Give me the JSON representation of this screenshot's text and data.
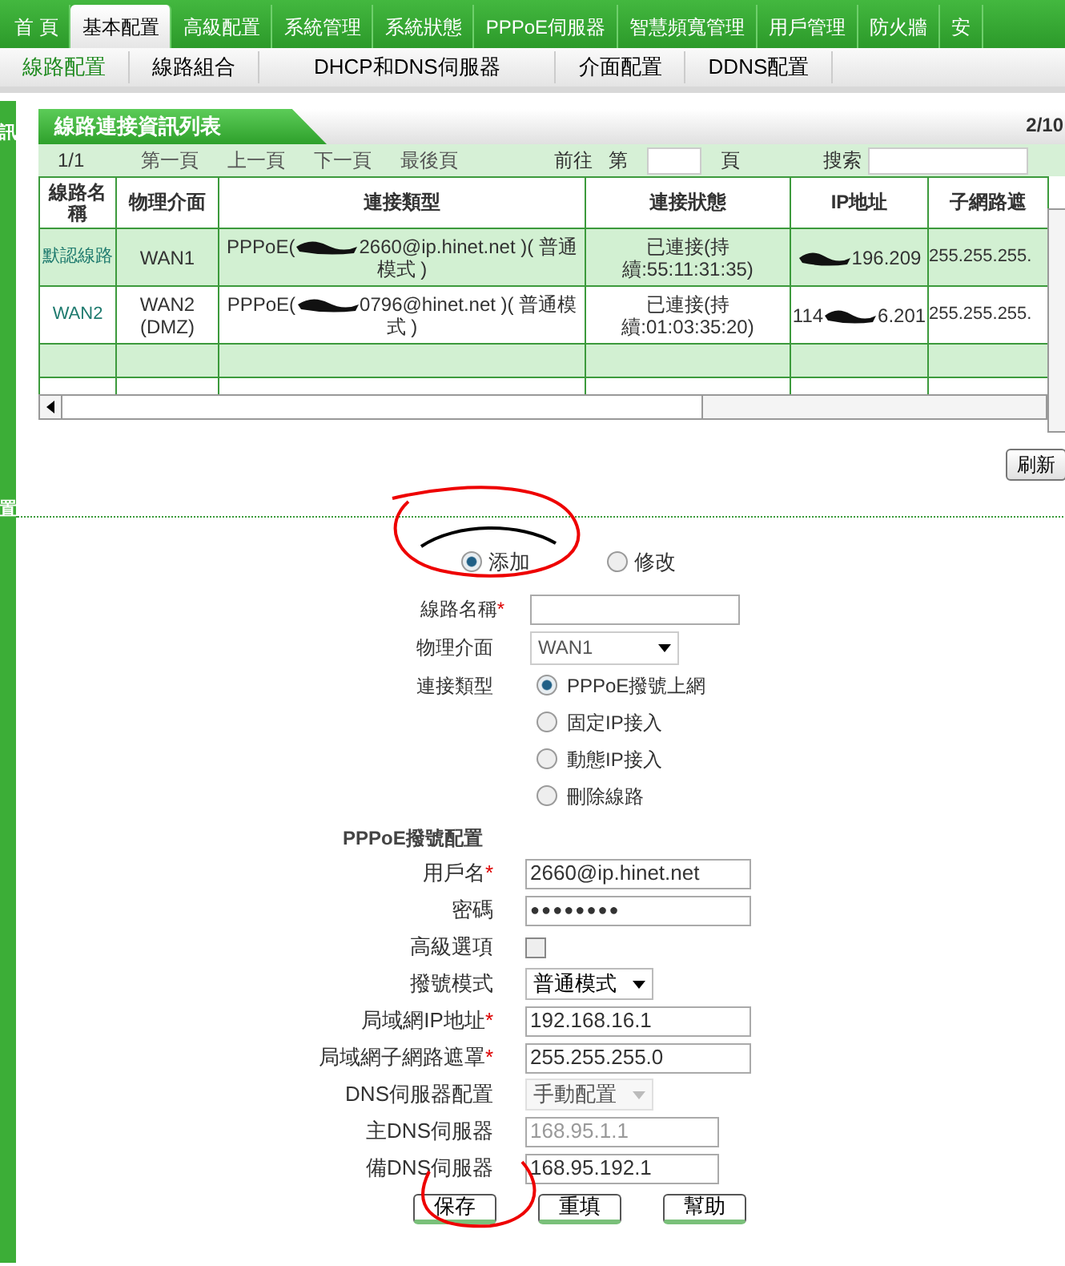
{
  "top_nav": [
    {
      "label": "首 頁",
      "selected": false
    },
    {
      "label": "基本配置",
      "selected": true
    },
    {
      "label": "高級配置",
      "selected": false
    },
    {
      "label": "系統管理",
      "selected": false
    },
    {
      "label": "系統狀態",
      "selected": false
    },
    {
      "label": "PPPoE伺服器",
      "selected": false
    },
    {
      "label": "智慧頻寬管理",
      "selected": false
    },
    {
      "label": "用戶管理",
      "selected": false
    },
    {
      "label": "防火牆",
      "selected": false
    },
    {
      "label": "安",
      "selected": false
    }
  ],
  "sub_nav": [
    {
      "label": "線路配置",
      "selected": true
    },
    {
      "label": "線路組合",
      "selected": false
    },
    {
      "label": "DHCP和DNS伺服器",
      "selected": false
    },
    {
      "label": "介面配置",
      "selected": false
    },
    {
      "label": "DDNS配置",
      "selected": false
    }
  ],
  "sidebar": {
    "labels": [
      "訊",
      "置"
    ]
  },
  "panel": {
    "title": "線路連接資訊列表",
    "count": "2/10",
    "pager": {
      "page": "1/1",
      "links": [
        "第一頁",
        "上一頁",
        "下一頁",
        "最後頁"
      ],
      "goto_prefix": "前往",
      "goto_mid": "第",
      "goto_suffix": "頁",
      "search_label": "搜索"
    },
    "table": {
      "columns": [
        "線路名稱",
        "物理介面",
        "連接類型",
        "連接狀態",
        "IP地址",
        "子網路遮"
      ],
      "rows": [
        {
          "name": "默認線路",
          "interface": "WAN1",
          "type_start": "PPPoE(",
          "type_end": "2660@ip.hinet.net )( 普通模式 )",
          "status": "已連接(持續:55:11:31:35)",
          "ip_start": "",
          "ip_end": "196.209",
          "mask": "255.255.255.",
          "highlight": true
        },
        {
          "name": "WAN2",
          "interface": "WAN2 (DMZ)",
          "type_start": "PPPoE(",
          "type_end": "0796@hinet.net )( 普通模式 )",
          "status": "已連接(持續:01:03:35:20)",
          "ip_start": "114",
          "ip_end": "6.201",
          "mask": "255.255.255.",
          "highlight": false
        }
      ]
    },
    "refresh_button": "刷新"
  },
  "mode": [
    {
      "label": "添加",
      "selected": true
    },
    {
      "label": "修改",
      "selected": false
    }
  ],
  "form": {
    "name_label": "線路名稱",
    "name_mark": "*",
    "interface_label": "物理介面",
    "interface_value": "WAN1",
    "type_label": "連接類型",
    "types": [
      {
        "label": "PPPoE撥號上網",
        "selected": true
      },
      {
        "label": "固定IP接入",
        "selected": false
      },
      {
        "label": "動態IP接入",
        "selected": false
      },
      {
        "label": "刪除線路",
        "selected": false
      }
    ]
  },
  "pppoe": {
    "title": "PPPoE撥號配置",
    "fields": [
      {
        "kind": "text",
        "label": "用戶名",
        "mark": "*",
        "value": "2660@ip.hinet.net",
        "disabled": false
      },
      {
        "kind": "password",
        "label": "密碼",
        "value": "●●●●●●●●",
        "disabled": false
      },
      {
        "kind": "checkbox",
        "label": "高級選項",
        "checked": false
      },
      {
        "kind": "select",
        "label": "撥號模式",
        "value": "普通模式",
        "disabled": false
      },
      {
        "kind": "text",
        "label": "局域網IP地址",
        "mark": "*",
        "value": "192.168.16.1",
        "disabled": false
      },
      {
        "kind": "text",
        "label": "局域網子網路遮罩",
        "mark": "*",
        "value": "255.255.255.0",
        "disabled": false
      },
      {
        "kind": "select",
        "label": "DNS伺服器配置",
        "value": "手動配置",
        "disabled": true
      },
      {
        "kind": "short",
        "label": "主DNS伺服器",
        "value": "168.95.1.1",
        "disabled": true
      },
      {
        "kind": "short",
        "label": "備DNS伺服器",
        "value": "168.95.192.1",
        "disabled": false
      }
    ]
  },
  "buttons": [
    "保存",
    "重填",
    "幫助"
  ]
}
